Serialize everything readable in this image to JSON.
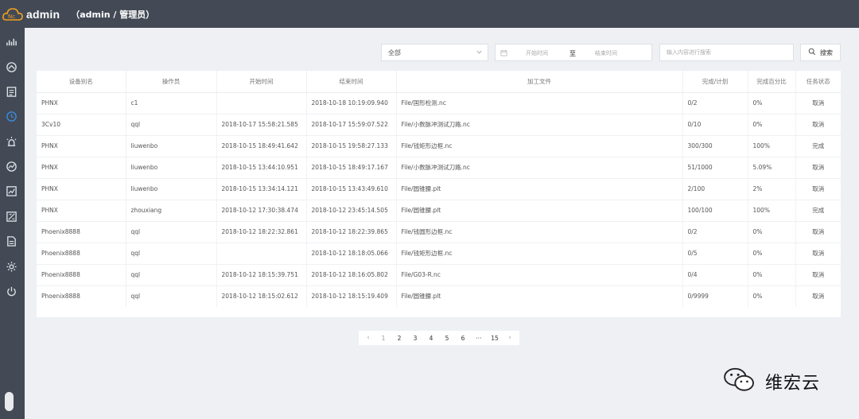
{
  "header": {
    "app_name": "admin",
    "user_role": "（admin / 管理员）"
  },
  "sidebar": {
    "icons": [
      "chart-icon",
      "dashboard-icon",
      "report-icon",
      "clock-icon",
      "alarm-icon",
      "trend-icon",
      "line-chart-icon",
      "analysis-icon",
      "document-icon",
      "settings-icon",
      "power-icon"
    ]
  },
  "toolbar": {
    "filter_value": "全部",
    "start_placeholder": "开始时间",
    "range_separator": "至",
    "end_placeholder": "结束时间",
    "search_placeholder": "输入内容进行搜索",
    "search_label": "搜索"
  },
  "table": {
    "columns": [
      "设备别名",
      "操作员",
      "开始时间",
      "结束时间",
      "加工文件",
      "完成/计划",
      "完成百分比",
      "任务状态"
    ],
    "rows": [
      {
        "device": "PHNX",
        "operator": "c1",
        "start": "",
        "end": "2018-10-18 10:19:09.940",
        "file": "File/国形检测.nc",
        "progress": "0/2",
        "percent": "0%",
        "status": "取消"
      },
      {
        "device": "3Cv10",
        "operator": "qql",
        "start": "2018-10-17 15:58:21.585",
        "end": "2018-10-17 15:59:07.522",
        "file": "File/小数脉冲测试刀路.nc",
        "progress": "0/10",
        "percent": "0%",
        "status": "取消"
      },
      {
        "device": "PHNX",
        "operator": "liuwenbo",
        "start": "2018-10-15 18:49:41.642",
        "end": "2018-10-15 19:58:27.133",
        "file": "File/钱矩形边框.nc",
        "progress": "300/300",
        "percent": "100%",
        "status": "完成"
      },
      {
        "device": "PHNX",
        "operator": "liuwenbo",
        "start": "2018-10-15 13:44:10.951",
        "end": "2018-10-15 18:49:17.167",
        "file": "File/小数脉冲测试刀路.nc",
        "progress": "51/1000",
        "percent": "5.09%",
        "status": "取消"
      },
      {
        "device": "PHNX",
        "operator": "liuwenbo",
        "start": "2018-10-15 13:34:14.121",
        "end": "2018-10-15 13:43:49.610",
        "file": "File/圆锥腰.plt",
        "progress": "2/100",
        "percent": "2%",
        "status": "取消"
      },
      {
        "device": "PHNX",
        "operator": "zhouxiang",
        "start": "2018-10-12 17:30:38.474",
        "end": "2018-10-12 23:45:14.505",
        "file": "File/圆锥腰.plt",
        "progress": "100/100",
        "percent": "100%",
        "status": "完成"
      },
      {
        "device": "Phoenix8888",
        "operator": "qql",
        "start": "2018-10-12 18:22:32.861",
        "end": "2018-10-12 18:22:39.865",
        "file": "File/钱圆形边框.nc",
        "progress": "0/2",
        "percent": "0%",
        "status": "取消"
      },
      {
        "device": "Phoenix8888",
        "operator": "qql",
        "start": "",
        "end": "2018-10-12 18:18:05.066",
        "file": "File/钱矩形边框.nc",
        "progress": "0/5",
        "percent": "0%",
        "status": "取消"
      },
      {
        "device": "Phoenix8888",
        "operator": "qql",
        "start": "2018-10-12 18:15:39.751",
        "end": "2018-10-12 18:16:05.802",
        "file": "File/G03-R.nc",
        "progress": "0/4",
        "percent": "0%",
        "status": "取消"
      },
      {
        "device": "Phoenix8888",
        "operator": "qql",
        "start": "2018-10-12 18:15:02.612",
        "end": "2018-10-12 18:15:19.409",
        "file": "File/圆锥腰.plt",
        "progress": "0/9999",
        "percent": "0%",
        "status": "取消"
      }
    ]
  },
  "pagination": {
    "prev_label": "‹",
    "pages": [
      "1",
      "2",
      "3",
      "4",
      "5",
      "6",
      "···",
      "15"
    ],
    "current": "1",
    "next_label": "›"
  },
  "watermark": {
    "text": "维宏云"
  }
}
